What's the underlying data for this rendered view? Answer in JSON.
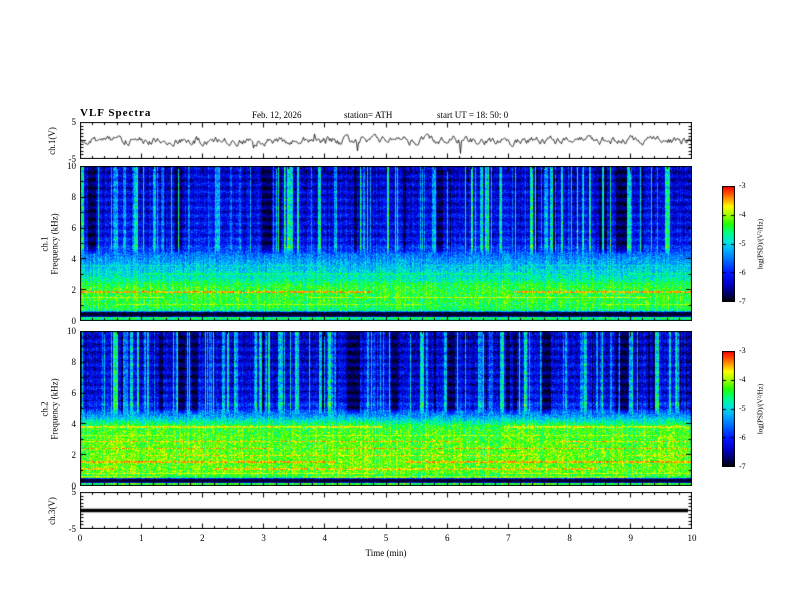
{
  "header": {
    "title": "VLF Spectra",
    "date": "Feb. 12, 2026",
    "station": "station= ATH",
    "start_ut": "start UT =  18: 50: 0"
  },
  "xaxis": {
    "label": "Time (min)",
    "ticks": [
      0,
      1,
      2,
      3,
      4,
      5,
      6,
      7,
      8,
      9,
      10
    ],
    "range": [
      0,
      10
    ]
  },
  "panels": {
    "ch1_wave": {
      "ylabel": "ch.1(V)",
      "yticks": [
        5,
        -5
      ],
      "yrange": [
        -5,
        5
      ]
    },
    "ch1_spec": {
      "ylabel_channel": "ch.1",
      "ylabel_axis": "Frequency (kHz)",
      "yticks": [
        0,
        2,
        4,
        6,
        8,
        10
      ],
      "yrange": [
        0,
        10
      ]
    },
    "ch2_spec": {
      "ylabel_channel": "ch.2",
      "ylabel_axis": "Frequency (kHz)",
      "yticks": [
        0,
        2,
        4,
        6,
        8,
        10
      ],
      "yrange": [
        0,
        10
      ]
    },
    "ch3_wave": {
      "ylabel": "ch.3(V)",
      "yticks": [
        5,
        -5
      ],
      "yrange": [
        -5,
        5
      ]
    }
  },
  "colorbar": {
    "label": "log(PSD)/(V²/Hz)",
    "ticks": [
      -3,
      -4,
      -5,
      -6,
      -7
    ],
    "range": [
      -7,
      -3
    ],
    "stops": [
      {
        "v": -7.0,
        "c": "#000000"
      },
      {
        "v": -6.8,
        "c": "#00004f"
      },
      {
        "v": -6.4,
        "c": "#0000c8"
      },
      {
        "v": -6.0,
        "c": "#0018ff"
      },
      {
        "v": -5.6,
        "c": "#0068ff"
      },
      {
        "v": -5.2,
        "c": "#00b2ff"
      },
      {
        "v": -4.9,
        "c": "#00e8d8"
      },
      {
        "v": -4.6,
        "c": "#00ff80"
      },
      {
        "v": -4.3,
        "c": "#22ff00"
      },
      {
        "v": -4.0,
        "c": "#9cff00"
      },
      {
        "v": -3.7,
        "c": "#ffff00"
      },
      {
        "v": -3.45,
        "c": "#ffa000"
      },
      {
        "v": -3.2,
        "c": "#ff4000"
      },
      {
        "v": -3.0,
        "c": "#ff0000"
      }
    ]
  },
  "chart_data": [
    {
      "type": "line",
      "panel": "ch.1 time series",
      "xlabel": "Time (min)",
      "ylabel": "ch.1(V)",
      "x_range": [
        0,
        10
      ],
      "y_range": [
        -5,
        5
      ],
      "description": "Broadband noise trace oscillating around 0 V with ~±1 V excursions and intermittent spikes over the full 10 minutes",
      "render": {
        "seed": 11,
        "ar": 0.72,
        "noise": 1.6,
        "spike_p": 0.012,
        "spike_amp": 2.4
      }
    },
    {
      "type": "heatmap",
      "panel": "ch.1 spectrogram",
      "xlabel": "Time (min)",
      "ylabel": "Frequency (kHz)",
      "zlabel": "log(PSD)/(V²/Hz)",
      "x_range": [
        0,
        10
      ],
      "y_range": [
        0,
        10
      ],
      "z_range": [
        -7,
        -3
      ],
      "features": {
        "background_levels": {
          "above_4p5_kHz": -6.2,
          "2_to_4_kHz": -4.9,
          "0p7_to_2p5_kHz": -4.35
        },
        "emission_lines_khz": [
          1.1,
          1.55,
          1.9,
          2.45,
          3.05
        ],
        "quiet_black_band_khz": [
          0.33,
          0.57
        ],
        "vertical_streaks": "dense green/cyan sferic burst columns and black dropout columns above ~4.5 kHz"
      },
      "render": {
        "seed": 202,
        "noise": 0.8,
        "profile": [
          [
            0,
            -6.6
          ],
          [
            0.12,
            -4.7
          ],
          [
            0.3,
            -4.5
          ],
          [
            0.33,
            -7
          ],
          [
            0.57,
            -7
          ],
          [
            0.68,
            -4.6
          ],
          [
            1.0,
            -4.4
          ],
          [
            2.2,
            -4.35
          ],
          [
            2.8,
            -4.8
          ],
          [
            3.4,
            -5.05
          ],
          [
            4.2,
            -5.45
          ],
          [
            4.8,
            -5.95
          ],
          [
            5.5,
            -6.15
          ],
          [
            8,
            -6.25
          ],
          [
            10,
            -6.4
          ]
        ],
        "bands": [
          [
            1.9,
            0.07,
            -3.45,
            0.5
          ],
          [
            1.55,
            0.06,
            -3.75,
            0.5
          ],
          [
            1.1,
            0.06,
            -3.95,
            0.6
          ],
          [
            2.45,
            0.06,
            -4.35,
            0.4
          ],
          [
            3.05,
            0.05,
            -4.6,
            0.4
          ],
          [
            3.6,
            0.05,
            -4.9,
            0.4
          ]
        ],
        "black_bands": [
          [
            0.33,
            0.57
          ],
          [
            0,
            0.06
          ]
        ],
        "streaks": {
          "cutoff": 4.3,
          "boost_start": 0.2,
          "boost_continue": 0.45,
          "boost_min": 0.7,
          "boost_max": 1.9,
          "drop_start": 0.035,
          "drop_continue": 0.72
        }
      }
    },
    {
      "type": "heatmap",
      "panel": "ch.2 spectrogram",
      "xlabel": "Time (min)",
      "ylabel": "Frequency (kHz)",
      "zlabel": "log(PSD)/(V²/Hz)",
      "x_range": [
        0,
        10
      ],
      "y_range": [
        0,
        10
      ],
      "z_range": [
        -7,
        -3
      ],
      "features": {
        "background_levels": {
          "above_5_kHz": -6.3,
          "below_4_kHz": -4.2
        },
        "emission_lines_khz": [
          0.62,
          0.85,
          1.15,
          1.6,
          2.0,
          2.45,
          2.9,
          3.3,
          3.85
        ],
        "quiet_black_band_khz": [
          0.27,
          0.47
        ],
        "vertical_streaks": "green burst columns with larger black dropout patches above ~4.6 kHz, denser toward the right"
      },
      "render": {
        "seed": 907,
        "noise": 0.85,
        "profile": [
          [
            0,
            -6.7
          ],
          [
            0.1,
            -4.5
          ],
          [
            0.22,
            -4.3
          ],
          [
            0.27,
            -7
          ],
          [
            0.47,
            -7
          ],
          [
            0.58,
            -4.5
          ],
          [
            0.9,
            -4.2
          ],
          [
            2.0,
            -4.15
          ],
          [
            3.2,
            -4.25
          ],
          [
            3.9,
            -4.35
          ],
          [
            4.4,
            -5.1
          ],
          [
            5.0,
            -5.9
          ],
          [
            5.8,
            -6.2
          ],
          [
            10,
            -6.35
          ]
        ],
        "bands": [
          [
            3.85,
            0.06,
            -3.7,
            0.45
          ],
          [
            3.3,
            0.05,
            -3.9,
            0.45
          ],
          [
            2.9,
            0.06,
            -3.55,
            0.4
          ],
          [
            2.45,
            0.06,
            -3.45,
            0.35
          ],
          [
            2.0,
            0.05,
            -3.6,
            0.4
          ],
          [
            1.6,
            0.06,
            -3.45,
            0.35
          ],
          [
            1.15,
            0.06,
            -3.55,
            0.4
          ],
          [
            0.85,
            0.05,
            -3.8,
            0.45
          ],
          [
            0.62,
            0.04,
            -4.0,
            0.5
          ]
        ],
        "black_bands": [
          [
            0.27,
            0.47
          ],
          [
            0,
            0.05
          ]
        ],
        "streaks": {
          "cutoff": 4.6,
          "boost_start": 0.18,
          "boost_continue": 0.5,
          "boost_min": 0.7,
          "boost_max": 1.8,
          "drop_start": 0.05,
          "drop_continue": 0.78
        }
      }
    },
    {
      "type": "line",
      "panel": "ch.3 time series",
      "xlabel": "Time (min)",
      "ylabel": "ch.3(V)",
      "x_range": [
        0,
        10
      ],
      "y_range": [
        -5,
        5
      ],
      "description": "Flat thick line at 0 V for the entire interval (no signal on channel 3)",
      "render": {
        "flat": true,
        "level": 0,
        "thickness": 3.5,
        "seed": 1
      }
    }
  ]
}
